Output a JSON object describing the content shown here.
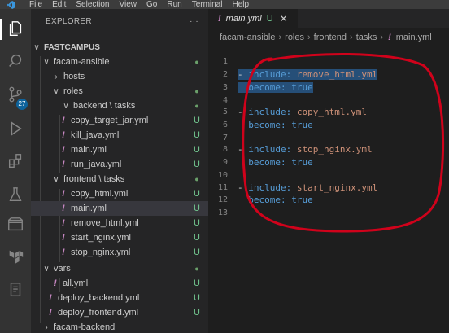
{
  "menu": [
    "File",
    "Edit",
    "Selection",
    "View",
    "Go",
    "Run",
    "Terminal",
    "Help"
  ],
  "explorer": {
    "title": "EXPLORER",
    "more": "···",
    "items": [
      {
        "label": "FASTCAMPUS",
        "chev": "∨",
        "status": ""
      },
      {
        "label": "facam-ansible",
        "chev": "∨",
        "status": "●"
      },
      {
        "label": "hosts",
        "chev": "›",
        "status": ""
      },
      {
        "label": "roles",
        "chev": "∨",
        "status": "●"
      },
      {
        "label": "backend \\ tasks",
        "chev": "∨",
        "status": "●"
      },
      {
        "label": "copy_target_jar.yml",
        "status": "U"
      },
      {
        "label": "kill_java.yml",
        "status": "U"
      },
      {
        "label": "main.yml",
        "status": "U"
      },
      {
        "label": "run_java.yml",
        "status": "U"
      },
      {
        "label": "frontend \\ tasks",
        "chev": "∨",
        "status": "●"
      },
      {
        "label": "copy_html.yml",
        "status": "U"
      },
      {
        "label": "main.yml",
        "status": "U"
      },
      {
        "label": "remove_html.yml",
        "status": "U"
      },
      {
        "label": "start_nginx.yml",
        "status": "U"
      },
      {
        "label": "stop_nginx.yml",
        "status": "U"
      },
      {
        "label": "vars",
        "chev": "∨",
        "status": "●"
      },
      {
        "label": "all.yml",
        "status": "U"
      },
      {
        "label": "deploy_backend.yml",
        "status": "U"
      },
      {
        "label": "deploy_frontend.yml",
        "status": "U"
      },
      {
        "label": "facam-backend",
        "chev": "›",
        "status": ""
      }
    ]
  },
  "activity_badge": "27",
  "tab": {
    "name": "main.yml",
    "status": "U",
    "close": "✕",
    "excl": "!"
  },
  "breadcrumb": [
    "facam-ansible",
    "roles",
    "frontend",
    "tasks"
  ],
  "breadcrumb_file": "main.yml",
  "code": {
    "line_numbers": [
      "1",
      "2",
      "3",
      "4",
      "5",
      "6",
      "7",
      "8",
      "9",
      "10",
      "11",
      "12",
      "13"
    ],
    "dash": "- ",
    "include_key": "include:",
    "become_key": "become:",
    "become_val": "true",
    "files": [
      "remove_html.yml",
      "copy_html.yml",
      "stop_nginx.yml",
      "start_nginx.yml"
    ]
  },
  "colors": {
    "accent": "#0e639c",
    "annotation": "#d0021b",
    "selection": "#264f78"
  }
}
